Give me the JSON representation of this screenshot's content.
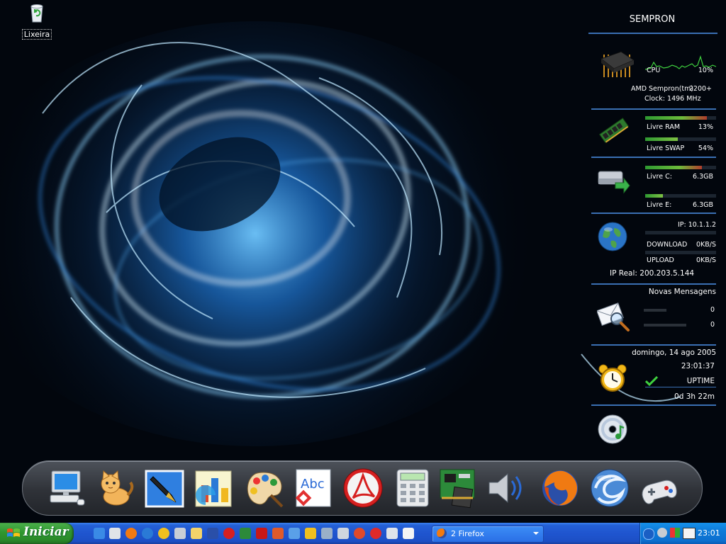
{
  "desktop": {
    "recycle_bin_label": "Lixeira"
  },
  "sidebar": {
    "title": "SEMPRON",
    "cpu": {
      "label": "CPU",
      "value": "10%",
      "model": "AMD Sempron(tm)",
      "model_rating": "2200+",
      "clock": "Clock: 1496 MHz",
      "graph_icon": "cpu-usage-graph"
    },
    "memory": {
      "ram_label": "Livre RAM",
      "ram_value": "13%",
      "ram_fraction": 0.87,
      "swap_label": "Livre SWAP",
      "swap_value": "54%",
      "swap_fraction": 0.46
    },
    "disks": {
      "c_label": "Livre C:",
      "c_value": "6.3GB",
      "c_fraction": 0.8,
      "e_label": "Livre E:",
      "e_value": "6.3GB",
      "e_fraction": 0.25
    },
    "network": {
      "ip": "IP: 10.1.1.2",
      "download_label": "DOWNLOAD",
      "download_value": "0KB/S",
      "upload_label": "UPLOAD",
      "upload_value": "0KB/S",
      "ip_real": "IP Real:  200.203.5.144"
    },
    "mail": {
      "title": "Novas Mensagens",
      "count1": "0",
      "count2": "0"
    },
    "datetime": {
      "date": "domingo, 14 ago 2005",
      "time": "23:01:37",
      "uptime_label": "UPTIME",
      "uptime_value": "0d 3h 22m"
    }
  },
  "dock": {
    "items": [
      "my-computer-icon",
      "cat-icon",
      "fountain-pen-icon",
      "chart-icon",
      "paint-palette-icon",
      "spellcheck-abc-icon",
      "acrobat-reader-icon",
      "calculator-icon",
      "hardware-board-icon",
      "speaker-volume-icon",
      "firefox-icon",
      "globe-swirl-icon",
      "gamepad-icon"
    ]
  },
  "taskbar": {
    "start_label": "Iniciar",
    "task_button_label": "2 Firefox",
    "clock": "23:01",
    "quicklaunch": [
      "ie-icon",
      "mail-icon",
      "firefox-icon",
      "ie-alt-icon",
      "media-icon",
      "drive-icon",
      "folder-icon",
      "word-icon",
      "opera-icon",
      "excel-icon",
      "pdf-icon",
      "image-icon",
      "network-icon",
      "pencil-icon",
      "computer-icon",
      "terminal-icon",
      "game-icon",
      "skype-icon",
      "save-icon",
      "cursor-icon"
    ]
  },
  "colors": {
    "accent": "#3a6fb3",
    "taskbar": "#245edc",
    "start": "#3a9a3a",
    "tray": "#0f7ad8"
  }
}
